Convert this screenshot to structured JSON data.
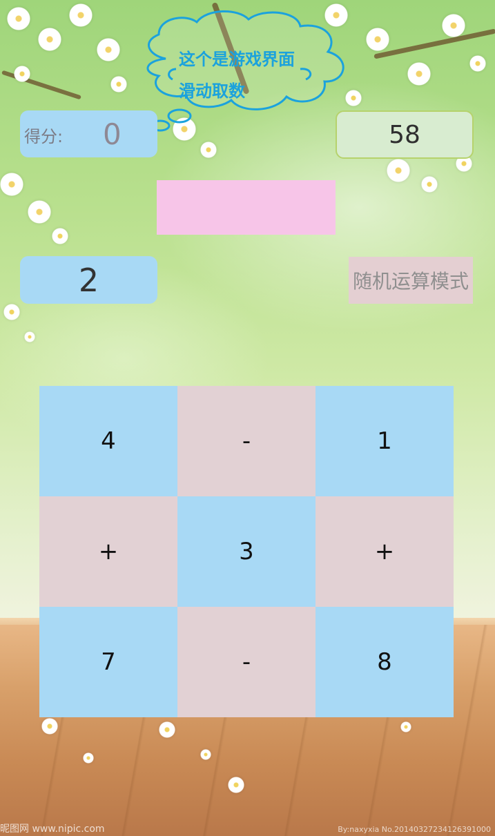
{
  "bubble": {
    "line1": "这个是游戏界面",
    "line2": "滑动取数"
  },
  "score": {
    "label": "得分:",
    "value": "0"
  },
  "timer": {
    "value": "58"
  },
  "target": {
    "value": "2"
  },
  "mode_button": {
    "label": "随机运算模式"
  },
  "grid": {
    "cells": [
      "4",
      "-",
      "1",
      "+",
      "3",
      "+",
      "7",
      "-",
      "8"
    ]
  },
  "watermark": {
    "left": "昵图网 www.nipic.com",
    "right": "By:naxyxia No.20140327234126391000"
  },
  "colors": {
    "cell_blue": "#a8d9f5",
    "cell_pink": "#e2d1d4",
    "pink_box": "#f7c5e8",
    "timer_bg": "#d8ecd0",
    "bubble_text": "#1ba2dd"
  }
}
